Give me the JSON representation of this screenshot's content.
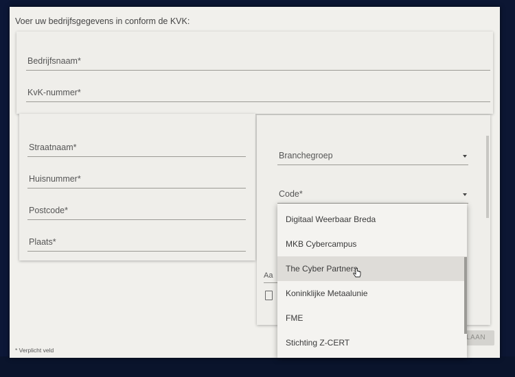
{
  "form": {
    "intro": "Voer uw bedrijfsgegevens in conform de KVK:",
    "company_name_label": "Bedrijfsnaam*",
    "kvk_label": "KvK-nummer*",
    "street_label": "Straatnaam*",
    "house_number_label": "Huisnummer*",
    "postcode_label": "Postcode*",
    "city_label": "Plaats*",
    "branch_group_label": "Branchegroep",
    "code_label": "Code*",
    "partial_label": "Aa",
    "required_note": "* Verplicht veld",
    "next_button": "LAAN"
  },
  "dropdown": {
    "options": [
      "Digitaal Weerbaar Breda",
      "MKB Cybercampus",
      "The Cyber Partners",
      "Koninklijke Metaalunie",
      "FME",
      "Stichting Z-CERT"
    ],
    "hovered_index": 2
  },
  "colors": {
    "screen_background": "#0e1b3a",
    "panel": "#f1f0ec",
    "hover": "#dedcd8"
  }
}
